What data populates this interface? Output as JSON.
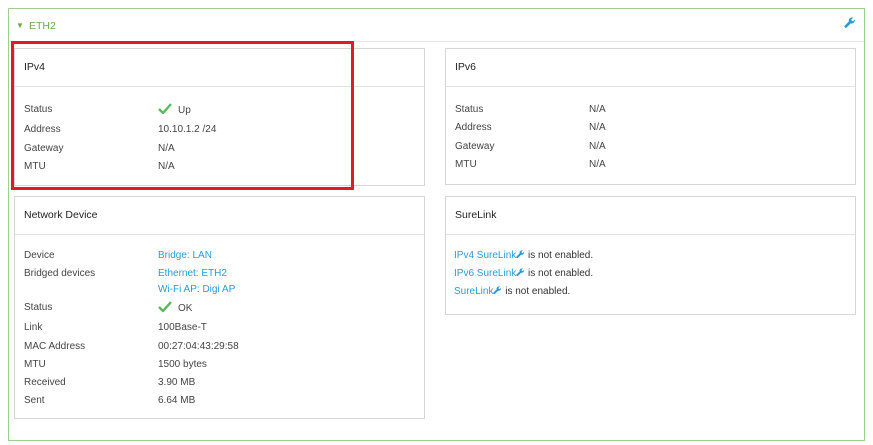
{
  "section": {
    "title": "ETH2",
    "caret_icon": "caret-down-icon",
    "config_icon": "wrench-icon",
    "accent_color": "#6aaa4a"
  },
  "ipv4": {
    "title": "IPv4",
    "status_label": "Status",
    "status_value": "Up",
    "address_label": "Address",
    "address_value": "10.10.1.2 /24",
    "gateway_label": "Gateway",
    "gateway_value": "N/A",
    "mtu_label": "MTU",
    "mtu_value": "N/A"
  },
  "ipv6": {
    "title": "IPv6",
    "status_label": "Status",
    "status_value": "N/A",
    "address_label": "Address",
    "address_value": "N/A",
    "gateway_label": "Gateway",
    "gateway_value": "N/A",
    "mtu_label": "MTU",
    "mtu_value": "N/A"
  },
  "network_device": {
    "title": "Network Device",
    "device_label": "Device",
    "device_value": "Bridge: LAN",
    "bridged_label": "Bridged devices",
    "bridged_value_1": "Ethernet: ETH2",
    "bridged_value_2": "Wi-Fi AP: Digi AP",
    "status_label": "Status",
    "status_value": "OK",
    "link_label": "Link",
    "link_value": "100Base-T",
    "mac_label": "MAC Address",
    "mac_value": "00:27:04:43:29:58",
    "mtu_label": "MTU",
    "mtu_value": "1500 bytes",
    "received_label": "Received",
    "received_value": "3.90 MB",
    "sent_label": "Sent",
    "sent_value": "6.64 MB"
  },
  "surelink": {
    "title": "SureLink",
    "ipv4_link": "IPv4 SureLink",
    "ipv6_link": "IPv6 SureLink",
    "surelink_link": "SureLink",
    "suffix": " is not enabled."
  },
  "colors": {
    "link": "#2a9ad6",
    "ok_check": "#5cb85c",
    "highlight": "#e01b24"
  }
}
